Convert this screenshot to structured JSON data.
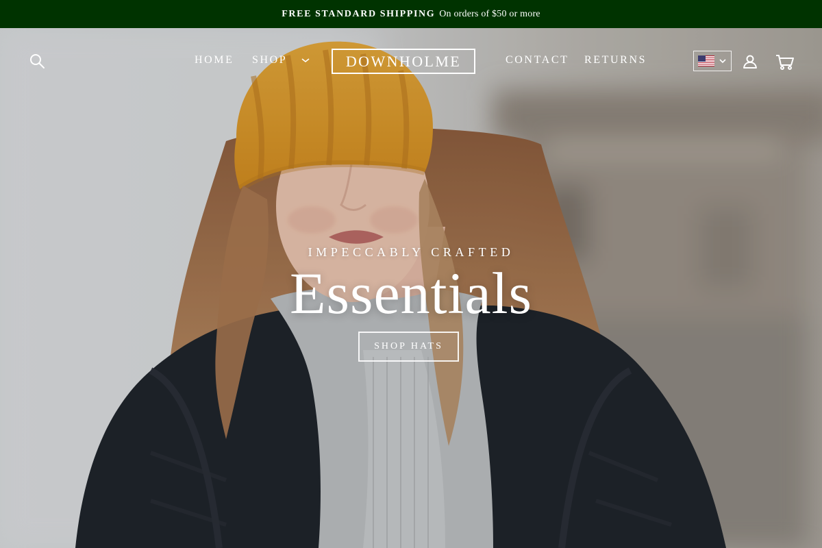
{
  "announcement": {
    "strong": "FREE STANDARD SHIPPING",
    "rest": "On orders of $50 or more"
  },
  "nav": {
    "home": "HOME",
    "shop": "SHOP",
    "contact": "CONTACT",
    "returns": "RETURNS"
  },
  "brand": {
    "logo": "DOWNHOLME"
  },
  "icons": {
    "search": "search-icon",
    "shop_dropdown": "chevron-down-icon",
    "locale_flag": "us-flag-icon",
    "locale_dropdown": "chevron-down-icon",
    "account": "account-icon",
    "cart": "cart-icon"
  },
  "hero": {
    "subheading": "IMPECCABLY CRAFTED",
    "headline": "Essentials",
    "cta": "SHOP HATS"
  },
  "colors": {
    "announcement_bg": "#003300",
    "text": "#ffffff",
    "beanie": "#d89a2a",
    "jacket": "#1f242b"
  }
}
